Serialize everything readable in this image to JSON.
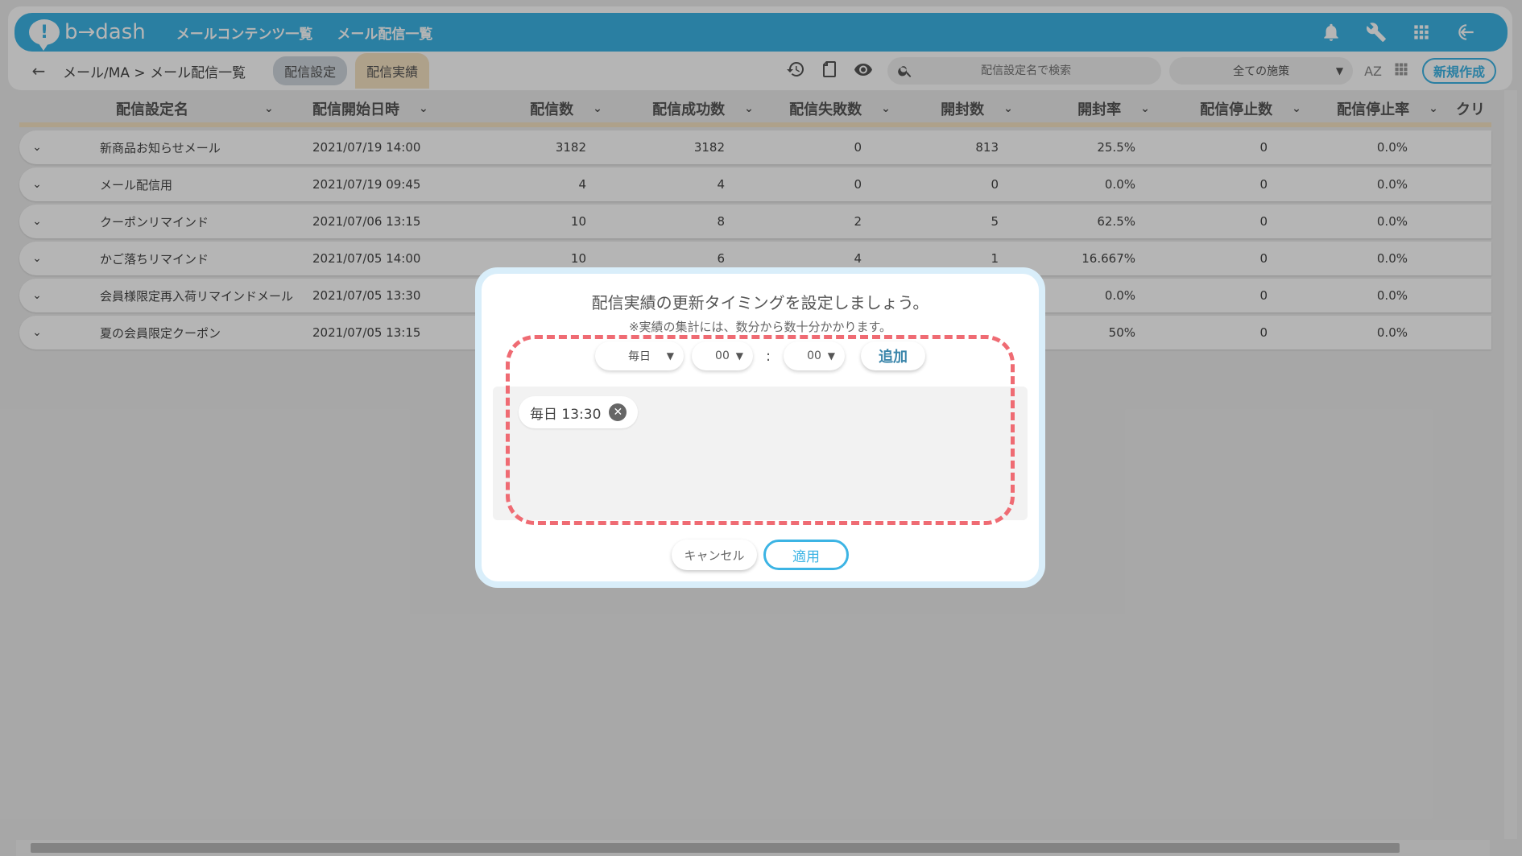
{
  "header": {
    "logo_text": "b→dash",
    "logo_mark": "!",
    "nav": [
      "メールコンテンツ一覧",
      "メール配信一覧"
    ],
    "icons": [
      "bell-icon",
      "wrench-icon",
      "apps-grid-icon",
      "logout-icon"
    ]
  },
  "subbar": {
    "back_icon": "←",
    "breadcrumb": "メール/MA > メール配信一覧",
    "tabs": [
      "配信設定",
      "配信実績"
    ],
    "search_placeholder": "配信設定名で検索",
    "filter_value": "全ての施策",
    "sort_label": "AZ",
    "new_button": "新規作成"
  },
  "table": {
    "columns": [
      "配信設定名",
      "配信開始日時",
      "配信数",
      "配信成功数",
      "配信失敗数",
      "開封数",
      "開封率",
      "配信停止数",
      "配信停止率",
      "クリ"
    ],
    "rows": [
      [
        "新商品お知らせメール",
        "2021/07/19 14:00",
        "3182",
        "3182",
        "0",
        "813",
        "25.5%",
        "0",
        "0.0%"
      ],
      [
        "メール配信用",
        "2021/07/19 09:45",
        "4",
        "4",
        "0",
        "0",
        "0.0%",
        "0",
        "0.0%"
      ],
      [
        "クーポンリマインド",
        "2021/07/06 13:15",
        "10",
        "8",
        "2",
        "5",
        "62.5%",
        "0",
        "0.0%"
      ],
      [
        "かご落ちリマインド",
        "2021/07/05 14:00",
        "10",
        "6",
        "4",
        "1",
        "16.667%",
        "0",
        "0.0%"
      ],
      [
        "会員様限定再入荷リマインドメール",
        "2021/07/05 13:30",
        "",
        "",
        "",
        "",
        "0.0%",
        "0",
        "0.0%"
      ],
      [
        "夏の会員限定クーポン",
        "2021/07/05 13:15",
        "",
        "",
        "",
        "",
        "50%",
        "0",
        "0.0%"
      ]
    ]
  },
  "modal": {
    "title": "配信実績の更新タイミングを設定しましょう。",
    "note": "※実績の集計には、数分から数十分かかります。",
    "day_select": "毎日",
    "hour_select": "00",
    "minute_select": "00",
    "colon": ":",
    "add_button": "追加",
    "chip": "毎日 13:30",
    "chip_remove": "✕",
    "cancel_button": "キャンセル",
    "apply_button": "適用"
  }
}
